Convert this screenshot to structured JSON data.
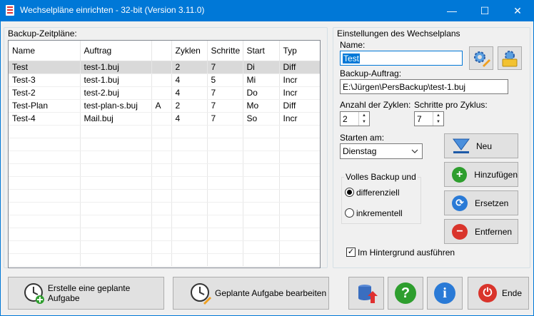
{
  "window": {
    "title": "Wechselpläne einrichten - 32-bit (Version 3.11.0)",
    "minimize": "—",
    "maximize": "☐",
    "close": "✕"
  },
  "left": {
    "list_label": "Backup-Zeitpläne:",
    "columns": [
      "Name",
      "Auftrag",
      "",
      "Zyklen",
      "Schritte",
      "Start",
      "Typ"
    ],
    "rows": [
      {
        "name": "Test",
        "auftrag": "test-1.buj",
        "flag": "",
        "zyklen": "2",
        "schritte": "7",
        "start": "Di",
        "typ": "Diff"
      },
      {
        "name": "Test-3",
        "auftrag": "test-1.buj",
        "flag": "",
        "zyklen": "4",
        "schritte": "5",
        "start": "Mi",
        "typ": "Incr"
      },
      {
        "name": "Test-2",
        "auftrag": "test-2.buj",
        "flag": "",
        "zyklen": "4",
        "schritte": "7",
        "start": "Do",
        "typ": "Incr"
      },
      {
        "name": "Test-Plan",
        "auftrag": "test-plan-s.buj",
        "flag": "A",
        "zyklen": "2",
        "schritte": "7",
        "start": "Mo",
        "typ": "Diff"
      },
      {
        "name": "Test-4",
        "auftrag": "Mail.buj",
        "flag": "",
        "zyklen": "4",
        "schritte": "7",
        "start": "So",
        "typ": "Incr"
      }
    ]
  },
  "right": {
    "group_label": "Einstellungen des Wechselplans",
    "name_label": "Name:",
    "name_value": "Test",
    "job_label": "Backup-Auftrag:",
    "job_value": "E:\\Jürgen\\PersBackup\\test-1.buj",
    "cycles_label": "Anzahl der Zyklen:",
    "cycles_value": "2",
    "steps_label": "Schritte pro Zyklus:",
    "steps_value": "7",
    "start_label": "Starten am:",
    "start_value": "Dienstag",
    "full_backup_label": "Volles Backup und",
    "radio_diff": "differenziell",
    "radio_incr": "inkrementell",
    "background_label": "Im Hintergrund ausführen",
    "btn_new": "Neu",
    "btn_add": "Hinzufügen",
    "btn_replace": "Ersetzen",
    "btn_remove": "Entfernen"
  },
  "bottom": {
    "create_task": "Erstelle eine geplante Aufgabe",
    "edit_task": "Geplante Aufgabe bearbeiten",
    "end": "Ende"
  },
  "colors": {
    "titlebar": "#0078d7",
    "selection": "#0078d7",
    "green": "#2e9e2e",
    "red": "#d9342b",
    "blue": "#2a7ad6"
  }
}
